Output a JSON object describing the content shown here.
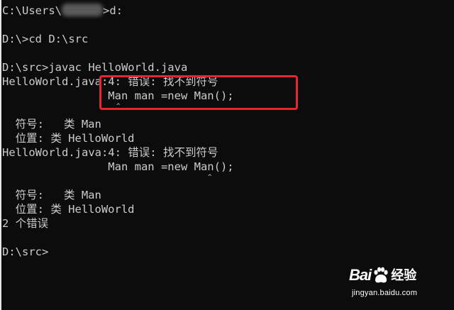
{
  "terminal": {
    "lines": [
      {
        "pre": "C:\\Users\\",
        "post": ">d:"
      },
      {
        "text": ""
      },
      {
        "text": "D:\\>cd D:\\src"
      },
      {
        "text": ""
      },
      {
        "text": "D:\\src>javac HelloWorld.java"
      },
      {
        "text": "HelloWorld.java:4: 错误: 找不到符号"
      },
      {
        "text": "                Man man =new Man();"
      },
      {
        "text": ""
      },
      {
        "text": "  符号:   类 Man"
      },
      {
        "text": "  位置: 类 HelloWorld"
      },
      {
        "text": "HelloWorld.java:4: 错误: 找不到符号"
      },
      {
        "text": "                Man man =new Man();"
      },
      {
        "text": ""
      },
      {
        "text": "  符号:   类 Man"
      },
      {
        "text": "  位置: 类 HelloWorld"
      },
      {
        "text": "2 个错误"
      },
      {
        "text": ""
      },
      {
        "text": "D:\\src>"
      }
    ],
    "caret_glyph": "^"
  },
  "watermark": {
    "brand_left": "Bai",
    "brand_right": "经验",
    "url": "jingyan.baidu.com"
  },
  "colors": {
    "background": "#0c0c0c",
    "text": "#cccccc",
    "highlight_box": "#e8242f"
  }
}
